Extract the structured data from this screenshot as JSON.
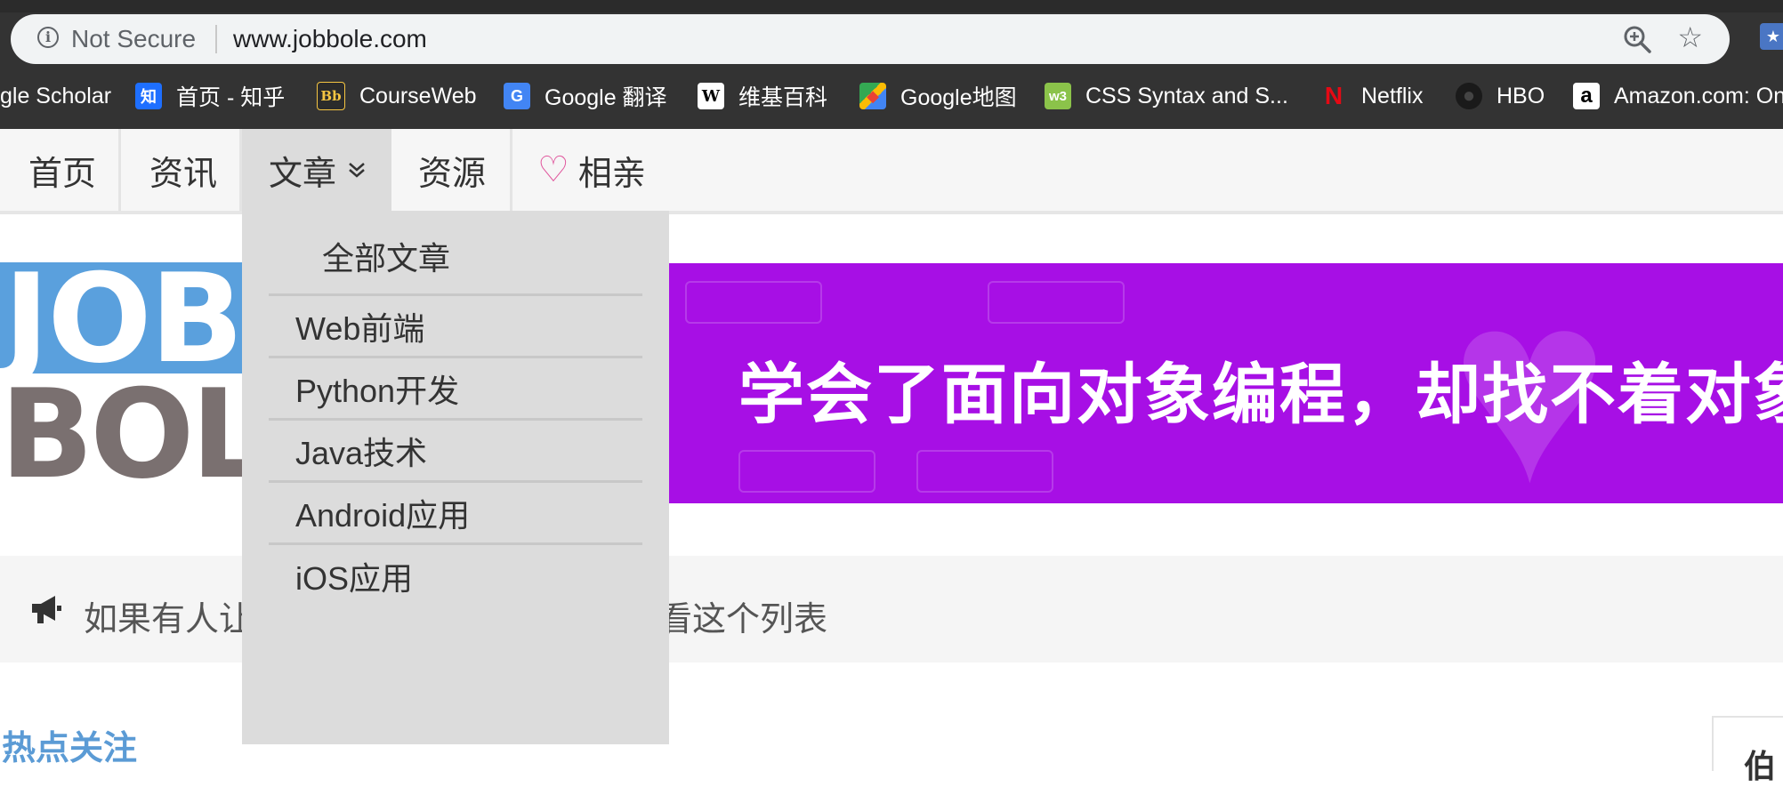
{
  "browser": {
    "security_label": "Not Secure",
    "url": "www.jobbole.com",
    "bookmarks": [
      {
        "label": "gle Scholar",
        "icon": "none"
      },
      {
        "label": "首页 - 知乎",
        "icon": "zhihu-icon",
        "glyph": "知",
        "color": "#1e6fff"
      },
      {
        "label": "CourseWeb",
        "icon": "blackboard-icon",
        "glyph": "Bb",
        "color": "#2b2b2b"
      },
      {
        "label": "Google 翻译",
        "icon": "google-translate-icon",
        "glyph": "G",
        "color": "#4285f4"
      },
      {
        "label": "维基百科",
        "icon": "wikipedia-icon",
        "glyph": "W",
        "color": "#ffffff"
      },
      {
        "label": "Google地图",
        "icon": "google-maps-icon",
        "glyph": "◆",
        "color": "#34a853"
      },
      {
        "label": "CSS Syntax and S...",
        "icon": "w3schools-icon",
        "glyph": "w3",
        "color": "#8bc34a"
      },
      {
        "label": "Netflix",
        "icon": "netflix-icon",
        "glyph": "N",
        "color": "#e50914"
      },
      {
        "label": "HBO",
        "icon": "hbo-icon",
        "glyph": "●",
        "color": "#1a1a1a"
      },
      {
        "label": "Amazon.com: On",
        "icon": "amazon-icon",
        "glyph": "a",
        "color": "#ffffff"
      }
    ]
  },
  "nav": {
    "items": [
      "首页",
      "资讯",
      "文章",
      "资源",
      "相亲"
    ],
    "dropdown_items": [
      "全部文章",
      "Web前端",
      "Python开发",
      "Java技术",
      "Android应用",
      "iOS应用"
    ]
  },
  "logo": {
    "line1": "JOB",
    "line2": "BOLE"
  },
  "banner": {
    "text": "学会了面向对象编程，却找不着对象"
  },
  "notice": {
    "text": "如果有人让你推荐编程技术书，请让他看这个列表"
  },
  "hot": {
    "title": "热点关注"
  },
  "sidebar": {
    "title_fragment": "伯"
  },
  "colors": {
    "accent_blue": "#5b9bd5",
    "banner_purple": "#a70fe5",
    "heart_pink": "#e0559c"
  }
}
